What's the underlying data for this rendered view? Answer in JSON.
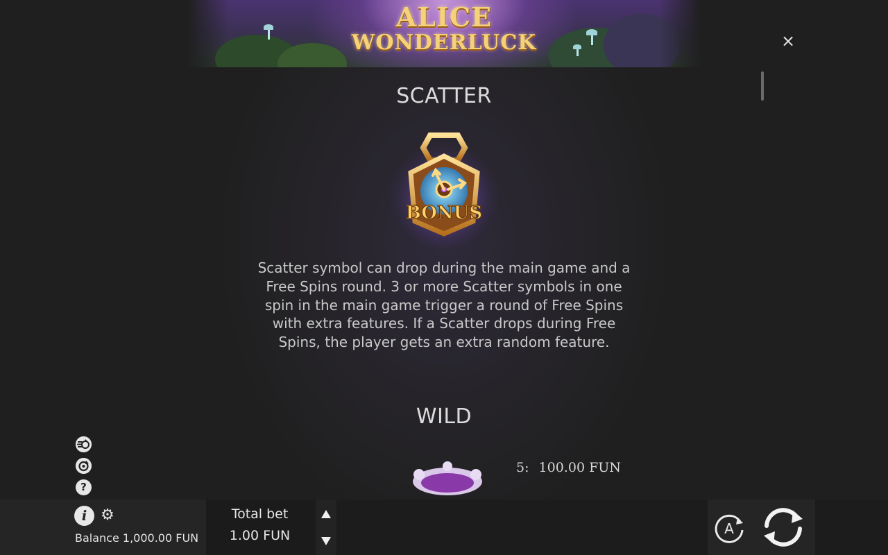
{
  "header": {
    "logo_line1": "ALICE",
    "logo_line2": "WONDERLUCK",
    "close_label": "×"
  },
  "paytable": {
    "scatter": {
      "title": "SCATTER",
      "symbol_label": "BONUS",
      "description": "Scatter symbol can drop during the main game and a Free Spins round. 3 or more Scatter symbols in one spin in the main game trigger a round of Free Spins with extra features. If a Scatter drops during Free Spins, the player gets an extra random feature."
    },
    "wild": {
      "title": "WILD",
      "payouts": [
        {
          "count": "5:",
          "amount": "100.00 FUN"
        }
      ]
    }
  },
  "side_icons": [
    {
      "name": "turbo-spin-icon"
    },
    {
      "name": "quick-spin-icon"
    },
    {
      "name": "help-icon",
      "glyph": "?"
    }
  ],
  "bottom_bar": {
    "info_glyph": "i",
    "settings_glyph": "⚙",
    "balance_text": "Balance 1,000.00 FUN",
    "total_bet_label": "Total bet",
    "total_bet_value": "1.00 FUN",
    "autoplay_label": "A"
  },
  "colors": {
    "background": "#1f1f1f",
    "gold": "#f5d27a",
    "purple_glow": "#8a4fb8"
  }
}
